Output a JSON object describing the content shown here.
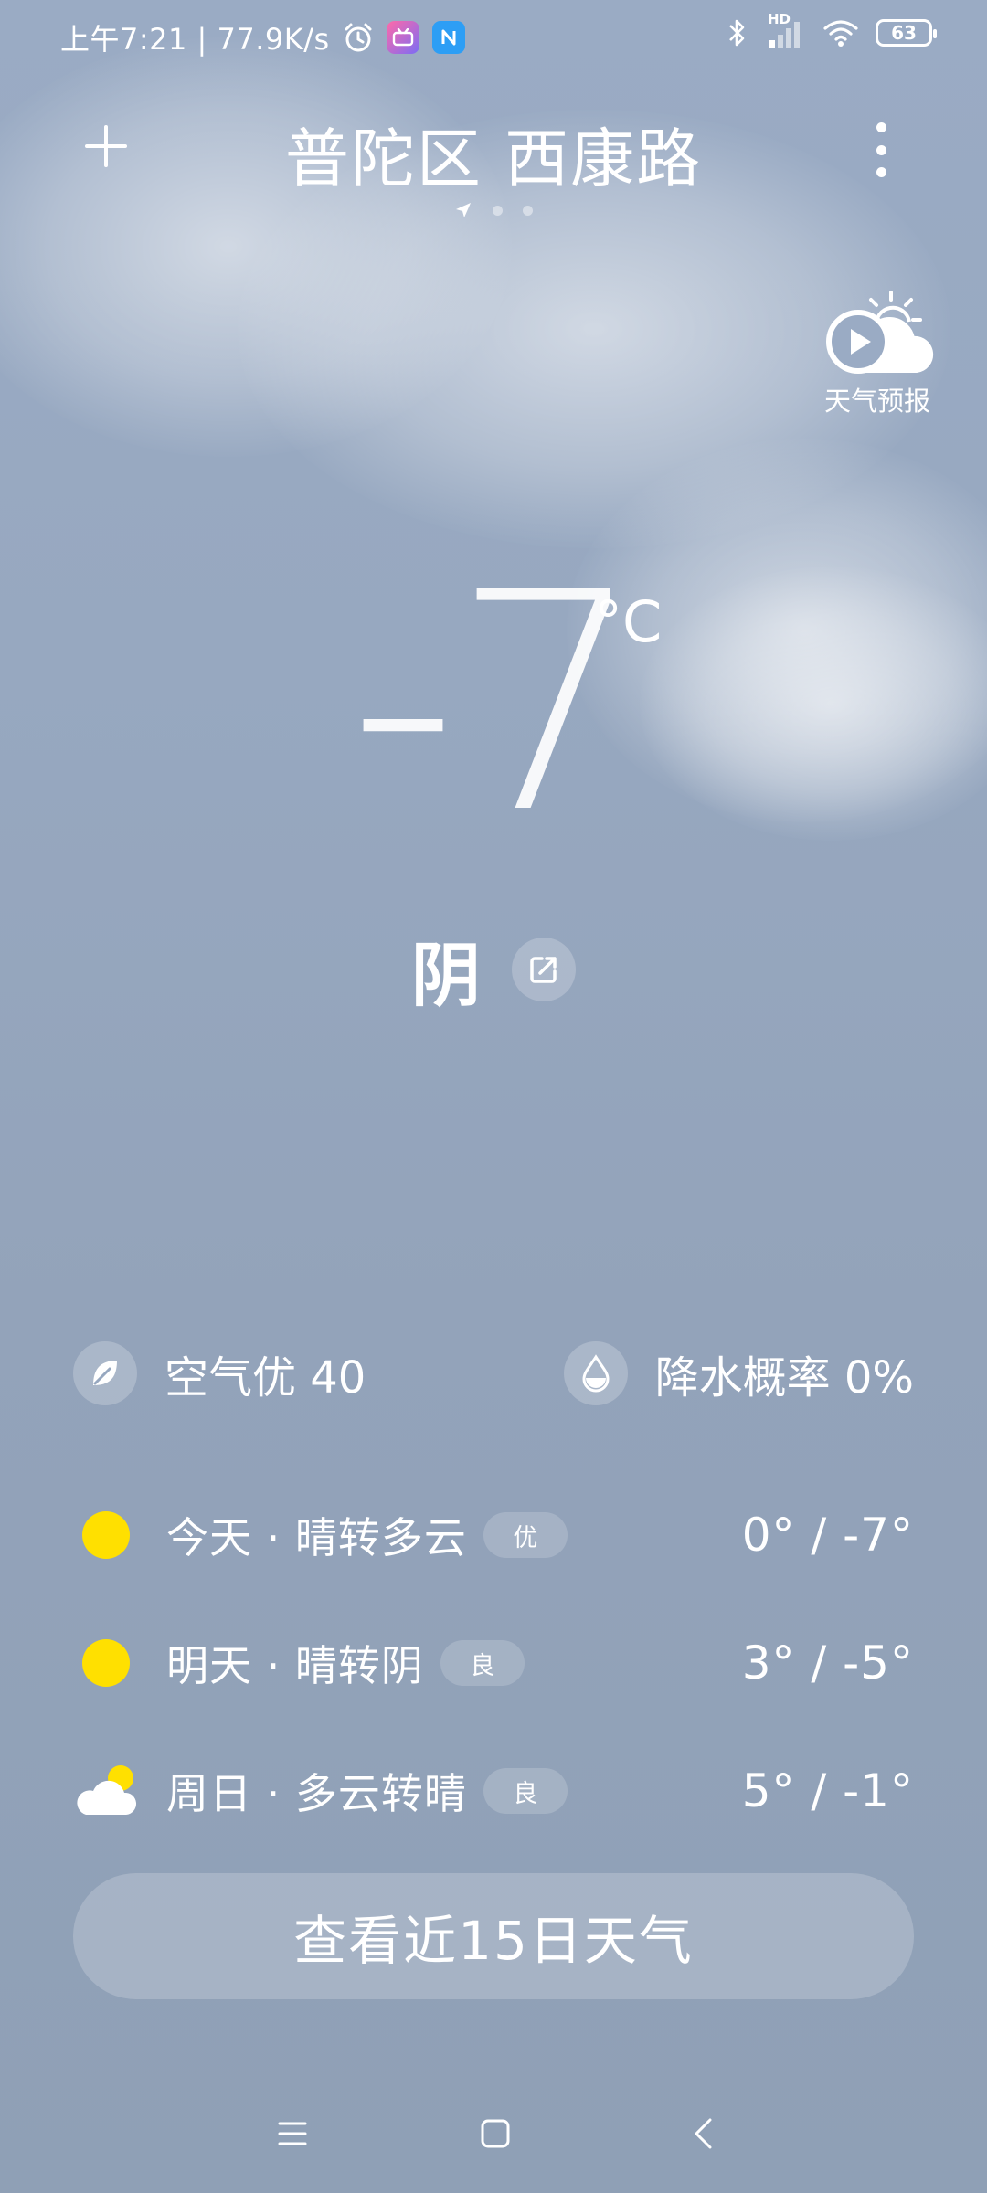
{
  "status_bar": {
    "time_speed": "上午7:21 | 77.9K/s",
    "battery": "63",
    "network_label": "HD"
  },
  "header": {
    "location": "普陀区 西康路",
    "add_icon": "plus-icon",
    "more_icon": "more-vertical-icon"
  },
  "forecast_video": {
    "label": "天气预报"
  },
  "current": {
    "temperature": "-7",
    "unit": "°C",
    "condition": "阴"
  },
  "stats": {
    "air": "空气优 40",
    "precip": "降水概率 0%"
  },
  "forecast": [
    {
      "day": "今天 · 晴转多云",
      "aqi": "优",
      "range": "0° / -7°",
      "icon": "sun-icon"
    },
    {
      "day": "明天 · 晴转阴",
      "aqi": "良",
      "range": "3° / -5°",
      "icon": "sun-icon"
    },
    {
      "day": "周日 · 多云转晴",
      "aqi": "良",
      "range": "5° / -1°",
      "icon": "partly-cloudy-icon"
    }
  ],
  "fifteen_day_button": "查看近15日天气",
  "colors": {
    "sun": "#ffe000",
    "background_top": "#9aabc4",
    "background_bottom": "#8fa0b6"
  }
}
